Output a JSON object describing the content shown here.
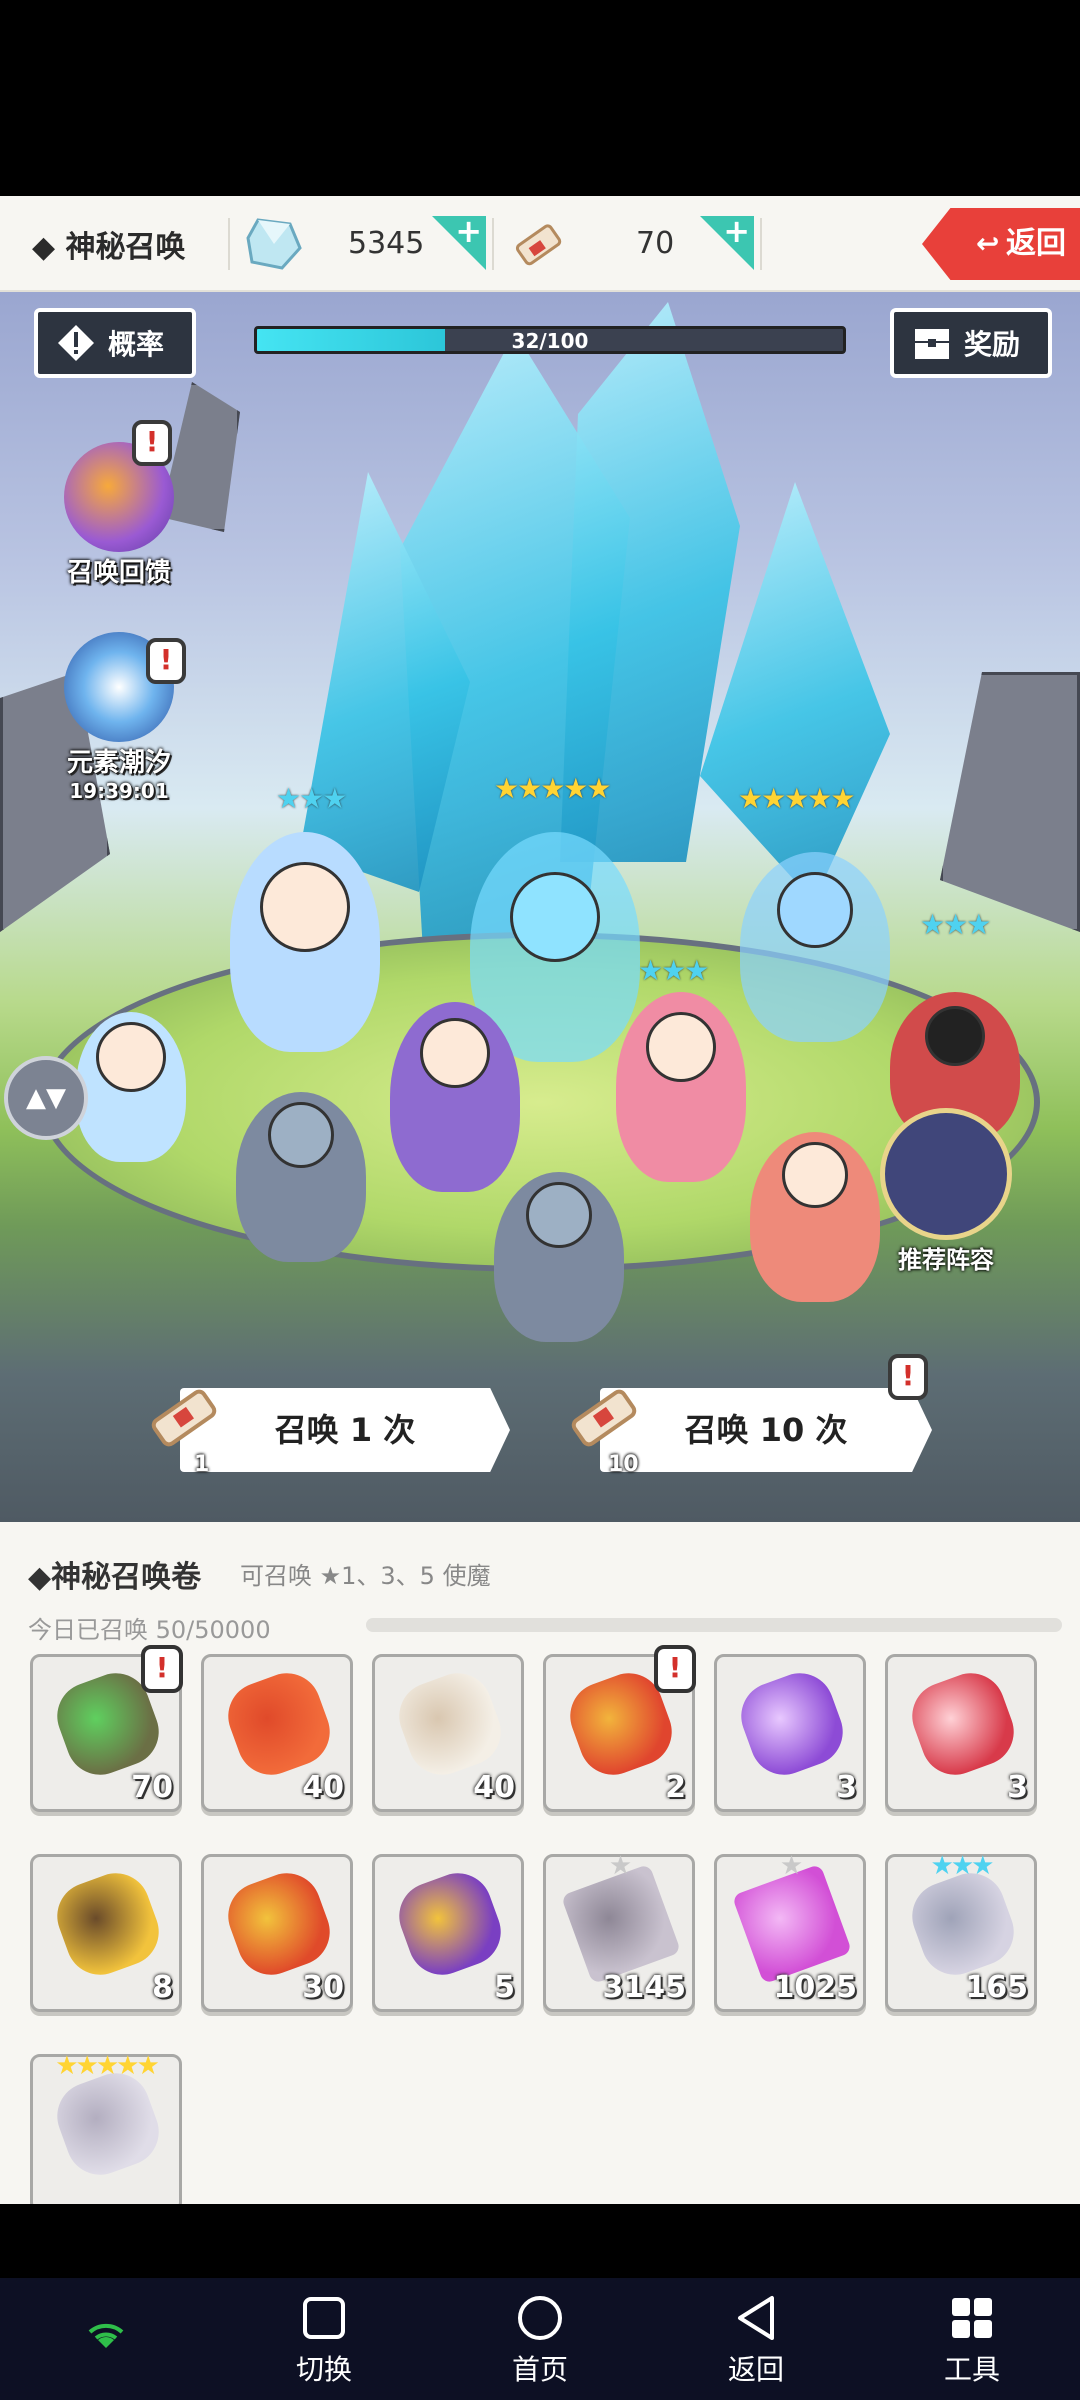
{
  "topbar": {
    "title": "◆ 神秘召唤",
    "gem_count": "5345",
    "scroll_count": "70",
    "back_label": "返回",
    "back_icon": "return-icon"
  },
  "scene": {
    "rate_label": "概率",
    "reward_label": "奖励",
    "progress_text": "32/100",
    "progress_value": 0.32,
    "side": [
      {
        "label": "召唤回馈",
        "icon": "summon-feedback-icon"
      },
      {
        "label": "元素潮汐",
        "timer": "19:39:01",
        "icon": "element-tide-icon"
      }
    ],
    "recommend_label": "推荐阵容",
    "summon_once": {
      "label": "召唤 1 次",
      "count": "1"
    },
    "summon_ten": {
      "label": "召唤 10 次",
      "count": "10"
    },
    "alert_mark": "!"
  },
  "inventory": {
    "title": "◆神秘召唤卷",
    "subtitle": "可召唤 ★1、3、5 使魔",
    "today": "今日已召唤 50/50000",
    "row1": [
      {
        "icon": "green-check-scroll-icon",
        "count": "70",
        "alert": true
      },
      {
        "icon": "heart-icon",
        "count": "40"
      },
      {
        "icon": "white-scroll-icon",
        "count": "40"
      },
      {
        "icon": "red-gift-icon",
        "count": "2",
        "alert": true
      },
      {
        "icon": "purple-scroll-icon",
        "count": "3"
      },
      {
        "icon": "red-scroll-icon",
        "count": "3"
      }
    ],
    "row2": [
      {
        "icon": "gold-scroll-icon",
        "count": "8"
      },
      {
        "icon": "red-gold-scroll-icon",
        "count": "30"
      },
      {
        "icon": "purple-gold-scroll-icon",
        "count": "5"
      },
      {
        "icon": "gray-shard-icon",
        "count": "3145",
        "stars": "★"
      },
      {
        "icon": "purple-shard-icon",
        "count": "1025",
        "stars": "★"
      },
      {
        "icon": "crystal-ring-icon",
        "count": "165",
        "stars": "★★★"
      }
    ],
    "row3": [
      {
        "icon": "silver-crystal-icon",
        "count": "",
        "stars": "★★★★★"
      }
    ]
  },
  "sysnav": {
    "switch": "切换",
    "home": "首页",
    "back": "返回",
    "tools": "工具"
  },
  "colors": {
    "accent": "#3cc6b1",
    "back_red": "#e8403a",
    "progress": "#45e4f2"
  }
}
